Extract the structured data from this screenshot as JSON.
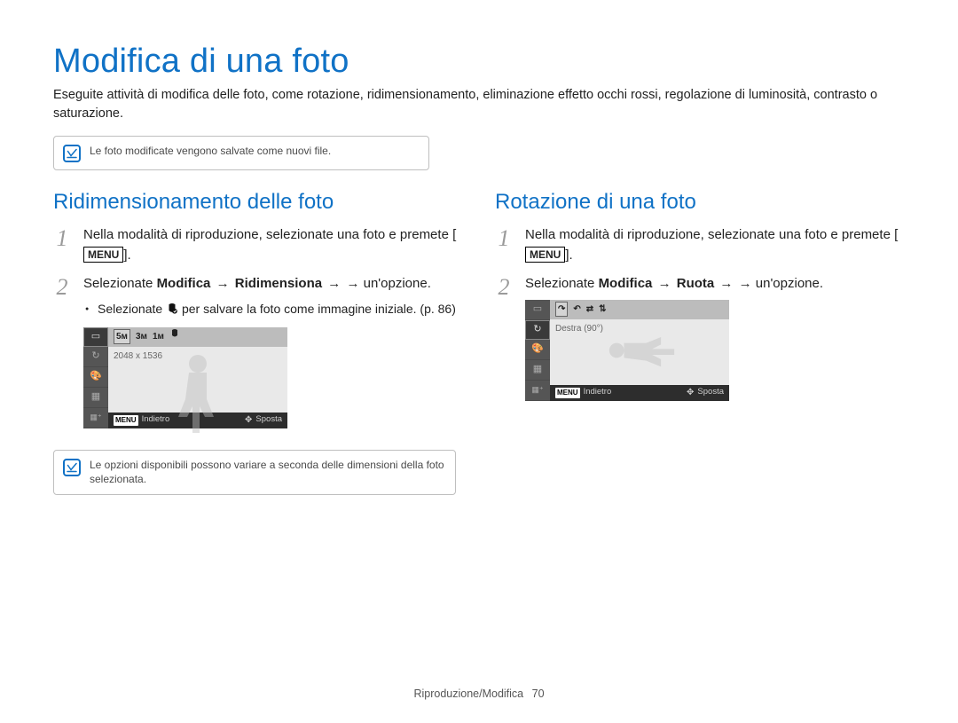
{
  "title": "Modifica di una foto",
  "intro": "Eseguite attività di modifica delle foto, come rotazione, ridimensionamento, eliminazione effetto occhi rossi, regolazione di luminosità, contrasto o saturazione.",
  "topnote": "Le foto modificate vengono salvate come nuovi file.",
  "menu_label": "MENU",
  "left": {
    "heading": "Ridimensionamento delle foto",
    "step1_a": "Nella modalità di riproduzione, selezionate una foto e premete [",
    "step1_b": "].",
    "step2_a": "Selezionate ",
    "step2_b1": "Modifica",
    "step2_arrow": " → ",
    "step2_b2": "Ridimensiona",
    "step2_c": " → un'opzione.",
    "bullet_a": "Selezionate ",
    "bullet_b": " per salvare la foto come immagine iniziale. (p. 86)",
    "lcd": {
      "top_options": [
        "5м",
        "3м",
        "1м"
      ],
      "canvas_text": "2048 x 1536",
      "back": "Indietro",
      "move": "Sposta"
    },
    "bottomnote": "Le opzioni disponibili possono variare a seconda delle dimensioni della foto selezionata."
  },
  "right": {
    "heading": "Rotazione di una foto",
    "step1_a": "Nella modalità di riproduzione, selezionate una foto e premete [",
    "step1_b": "].",
    "step2_a": "Selezionate ",
    "step2_b1": "Modifica",
    "step2_arrow": " → ",
    "step2_b2": "Ruota",
    "step2_c": " → un'opzione.",
    "lcd": {
      "canvas_text": "Destra (90°)",
      "back": "Indietro",
      "move": "Sposta"
    }
  },
  "footer_section": "Riproduzione/Modifica",
  "footer_page": "70"
}
